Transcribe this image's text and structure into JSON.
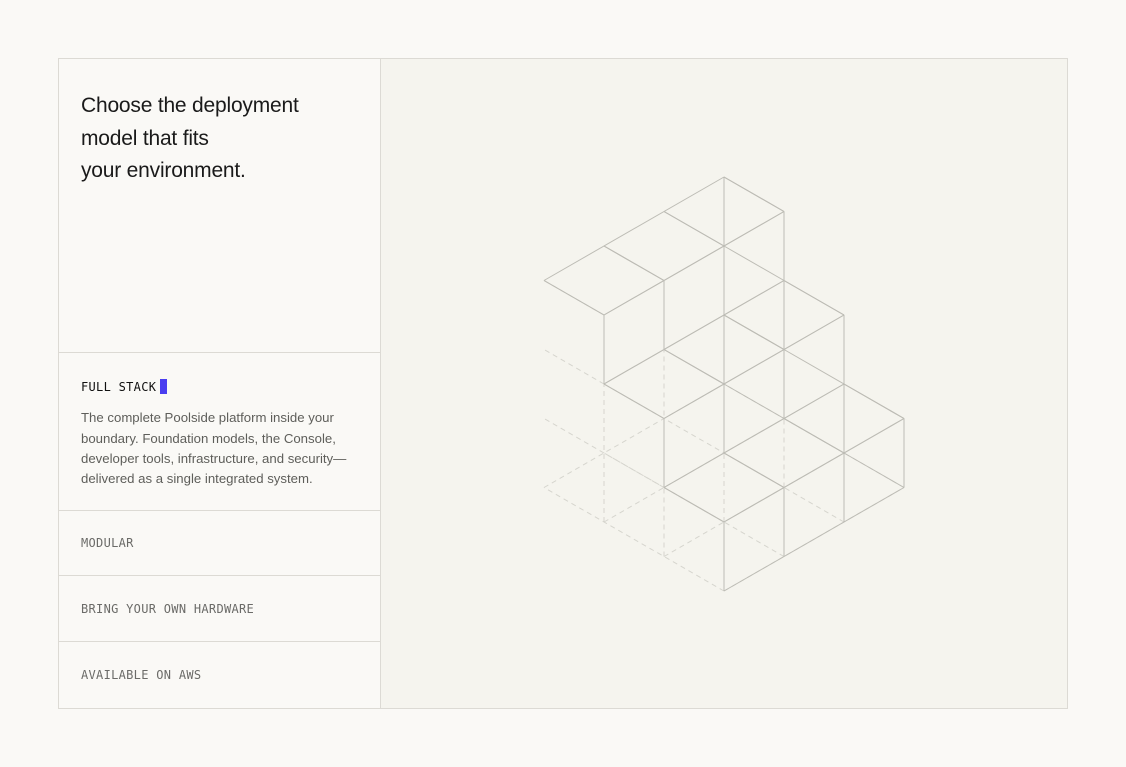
{
  "heading": {
    "line1": "Choose the deployment",
    "line2": "model that fits",
    "line3": "your environment."
  },
  "options": [
    {
      "title": "FULL STACK",
      "active": true,
      "description": "The complete Poolside platform inside your boundary. Foundation models, the Console, developer tools, infrastructure, and security—delivered as a single integrated system."
    },
    {
      "title": "MODULAR",
      "active": false
    },
    {
      "title": "BRING YOUR OWN HARDWARE",
      "active": false
    },
    {
      "title": "AVAILABLE ON AWS",
      "active": false
    }
  ],
  "colors": {
    "accent": "#4a3ef0",
    "background": "#faf9f6",
    "panel": "#f5f4ee",
    "border": "#dcdad4",
    "line": "#bdbcb5"
  },
  "illustration": {
    "icon": "isometric-cube-stack-icon",
    "columns": [
      {
        "row": 0,
        "heights": [
          1,
          1,
          1
        ]
      },
      {
        "row": 1,
        "heights": [
          2,
          2,
          2
        ]
      },
      {
        "row": 2,
        "heights": [
          3,
          3,
          3
        ]
      }
    ]
  }
}
